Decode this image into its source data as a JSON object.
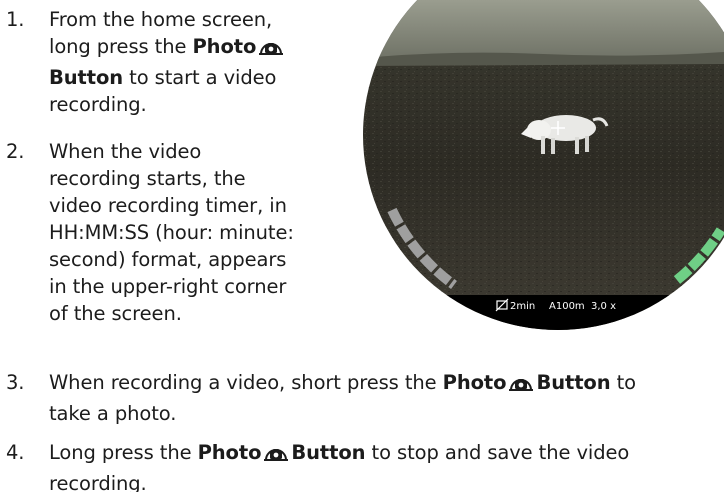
{
  "steps": [
    {
      "number": "1.",
      "lines": [
        [
          {
            "t": "From the home screen,"
          }
        ],
        [
          {
            "t": "long press the "
          },
          {
            "t": "Photo",
            "b": true
          },
          {
            "icon": "camera"
          }
        ],
        [
          {
            "t": "Button",
            "b": true
          },
          {
            "t": " to start a video"
          }
        ],
        [
          {
            "t": "recording."
          }
        ]
      ]
    },
    {
      "number": "2.",
      "lines": [
        [
          {
            "t": "When the video"
          }
        ],
        [
          {
            "t": "recording starts, the"
          }
        ],
        [
          {
            "t": "video recording timer, in"
          }
        ],
        [
          {
            "t": "HH:MM:SS (hour: minute:"
          }
        ],
        [
          {
            "t": "second) format, appears"
          }
        ],
        [
          {
            "t": "in the upper-right corner"
          }
        ],
        [
          {
            "t": "of the screen."
          }
        ]
      ]
    },
    {
      "number": "3.",
      "lines": [
        [
          {
            "t": "When recording a video, short press the "
          },
          {
            "t": "Photo",
            "b": true
          },
          {
            "icon": "camera"
          },
          {
            "t": "Button",
            "b": true
          },
          {
            "t": " to"
          }
        ],
        [
          {
            "t": "take a photo."
          }
        ]
      ]
    },
    {
      "number": "4.",
      "lines": [
        [
          {
            "t": "Long press the "
          },
          {
            "t": "Photo",
            "b": true
          },
          {
            "icon": "camera"
          },
          {
            "t": "Button",
            "b": true
          },
          {
            "t": " to stop and save the video"
          }
        ],
        [
          {
            "t": "recording."
          }
        ]
      ]
    }
  ],
  "scope": {
    "status_timer": "2min",
    "status_range": "A100m",
    "status_zoom": "3,0 x",
    "icons": [
      "no-wifi-icon",
      "crosshair-icon"
    ],
    "colors": {
      "sky": "#8f9383",
      "ground": "#2f2d25",
      "hud_bar": "#000000",
      "left_gauge": "#b8b8b8",
      "right_gauge": "#6fcf86"
    }
  }
}
